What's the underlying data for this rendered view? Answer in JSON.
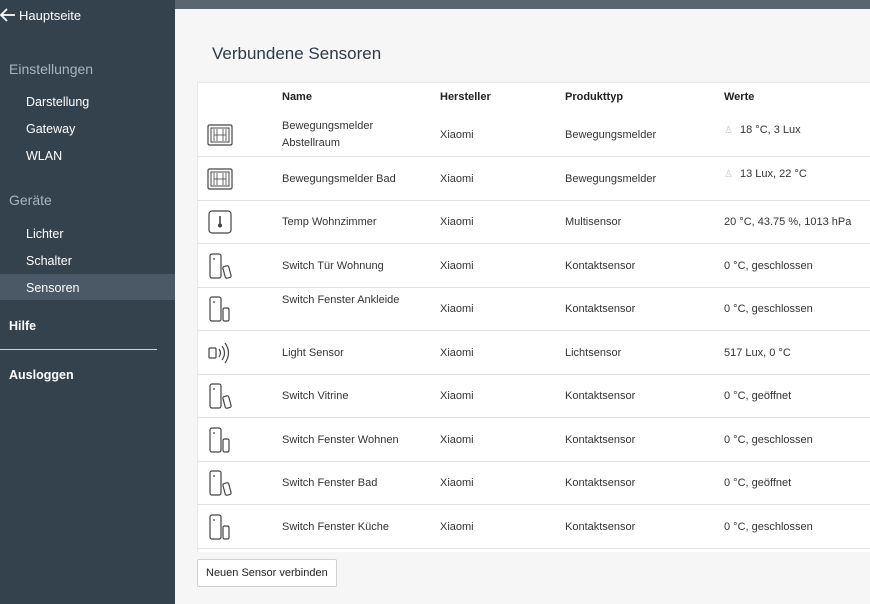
{
  "sidebar": {
    "home_label": "Hauptseite",
    "settings_header": "Einstellungen",
    "settings_items": [
      "Darstellung",
      "Gateway",
      "WLAN"
    ],
    "devices_header": "Geräte",
    "devices_items": [
      "Lichter",
      "Schalter",
      "Sensoren"
    ],
    "active_item": "Sensoren",
    "help_label": "Hilfe",
    "logout_label": "Ausloggen"
  },
  "main": {
    "title": "Verbundene Sensoren",
    "columns": [
      "Name",
      "Hersteller",
      "Produkttyp",
      "Werte"
    ],
    "rows": [
      {
        "icon": "motion-sensor-icon",
        "name": "Bewegungsmelder Abstellraum",
        "maker": "Xiaomi",
        "type": "Bewegungsmelder",
        "value_icon": "person-icon",
        "value": "18 °C, 3 Lux"
      },
      {
        "icon": "motion-sensor-icon",
        "name": "Bewegungsmelder Bad",
        "maker": "Xiaomi",
        "type": "Bewegungsmelder",
        "value_icon": "person-icon",
        "value": "13 Lux, 22 °C"
      },
      {
        "icon": "thermometer-icon",
        "name": "Temp Wohnzimmer",
        "maker": "Xiaomi",
        "type": "Multisensor",
        "value_icon": "",
        "value": "20 °C, 43.75 %, 1013 hPa"
      },
      {
        "icon": "contact-open-icon",
        "name": "Switch Tür Wohnung",
        "maker": "Xiaomi",
        "type": "Kontaktsensor",
        "value_icon": "",
        "value": "0 °C, geschlossen"
      },
      {
        "icon": "contact-closed-icon",
        "name": "Switch Fenster Ankleide",
        "maker": "Xiaomi",
        "type": "Kontaktsensor",
        "value_icon": "",
        "value": "0 °C, geschlossen"
      },
      {
        "icon": "light-sensor-icon",
        "name": "Light Sensor",
        "maker": "Xiaomi",
        "type": "Lichtsensor",
        "value_icon": "",
        "value": "517 Lux, 0 °C"
      },
      {
        "icon": "contact-open-icon",
        "name": "Switch Vitrine",
        "maker": "Xiaomi",
        "type": "Kontaktsensor",
        "value_icon": "",
        "value": "0 °C, geöffnet"
      },
      {
        "icon": "contact-closed-icon",
        "name": "Switch Fenster Wohnen",
        "maker": "Xiaomi",
        "type": "Kontaktsensor",
        "value_icon": "",
        "value": "0 °C, geschlossen"
      },
      {
        "icon": "contact-open-icon",
        "name": "Switch Fenster Bad",
        "maker": "Xiaomi",
        "type": "Kontaktsensor",
        "value_icon": "",
        "value": "0 °C, geöffnet"
      },
      {
        "icon": "contact-closed-icon",
        "name": "Switch Fenster Küche",
        "maker": "Xiaomi",
        "type": "Kontaktsensor",
        "value_icon": "",
        "value": "0 °C, geschlossen"
      }
    ],
    "connect_button": "Neuen Sensor verbinden"
  }
}
